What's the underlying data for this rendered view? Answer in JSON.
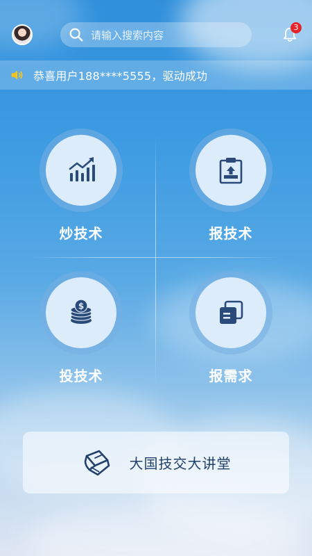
{
  "header": {
    "search_placeholder": "请输入搜索内容",
    "notification_count": "3"
  },
  "notice": {
    "text": "恭喜用户188****5555，驱动成功"
  },
  "menu": {
    "items": [
      {
        "label": "炒技术",
        "icon": "chart-bars-icon"
      },
      {
        "label": "报技术",
        "icon": "clipboard-upload-icon"
      },
      {
        "label": "投技术",
        "icon": "coins-stack-icon"
      },
      {
        "label": "报需求",
        "icon": "documents-icon"
      }
    ]
  },
  "lecture": {
    "label": "大国技交大讲堂",
    "icon": "book-icon"
  },
  "colors": {
    "accent_icon": "#2a4a7a",
    "badge": "#e6242b",
    "notice_speaker": "#f5c518"
  }
}
